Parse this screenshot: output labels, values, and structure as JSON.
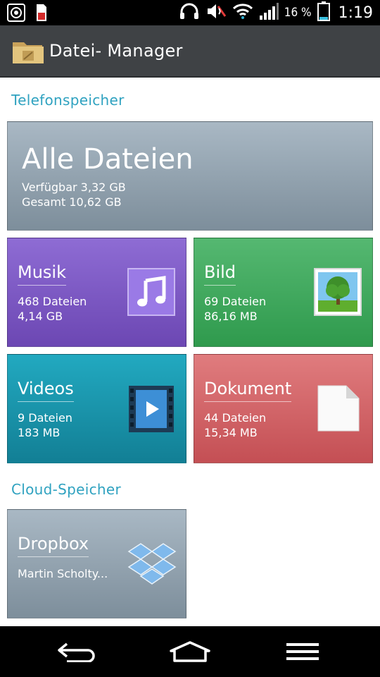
{
  "status_bar": {
    "battery_percent": "16 %",
    "time": "1:19",
    "icons": [
      "media-icon",
      "sd-card-icon",
      "headphones-icon",
      "mute-icon",
      "wifi-icon",
      "signal-icon",
      "battery-icon"
    ]
  },
  "app": {
    "title": "Datei- Manager",
    "icon": "folder-icon"
  },
  "sections": {
    "phone_storage": "Telefonspeicher",
    "cloud_storage": "Cloud-Speicher"
  },
  "all_files": {
    "title": "Alle Dateien",
    "available": "Verfügbar 3,32 GB",
    "total": "Gesamt 10,62 GB"
  },
  "categories": {
    "music": {
      "title": "Musik",
      "count": "468 Dateien",
      "size": "4,14 GB",
      "icon": "music-note-icon",
      "color": "#7b58c4"
    },
    "picture": {
      "title": "Bild",
      "count": "69 Dateien",
      "size": "86,16 MB",
      "icon": "picture-icon",
      "color": "#3ea95d"
    },
    "videos": {
      "title": "Videos",
      "count": "9 Dateien",
      "size": "183 MB",
      "icon": "video-film-icon",
      "color": "#1795ab"
    },
    "documents": {
      "title": "Dokument",
      "count": "44 Dateien",
      "size": "15,34 MB",
      "icon": "document-icon",
      "color": "#d2656a"
    }
  },
  "cloud": {
    "dropbox": {
      "title": "Dropbox",
      "account": "Martin Scholty...",
      "icon": "dropbox-icon"
    }
  },
  "nav": {
    "icons": [
      "back-icon",
      "home-icon",
      "menu-icon"
    ]
  }
}
